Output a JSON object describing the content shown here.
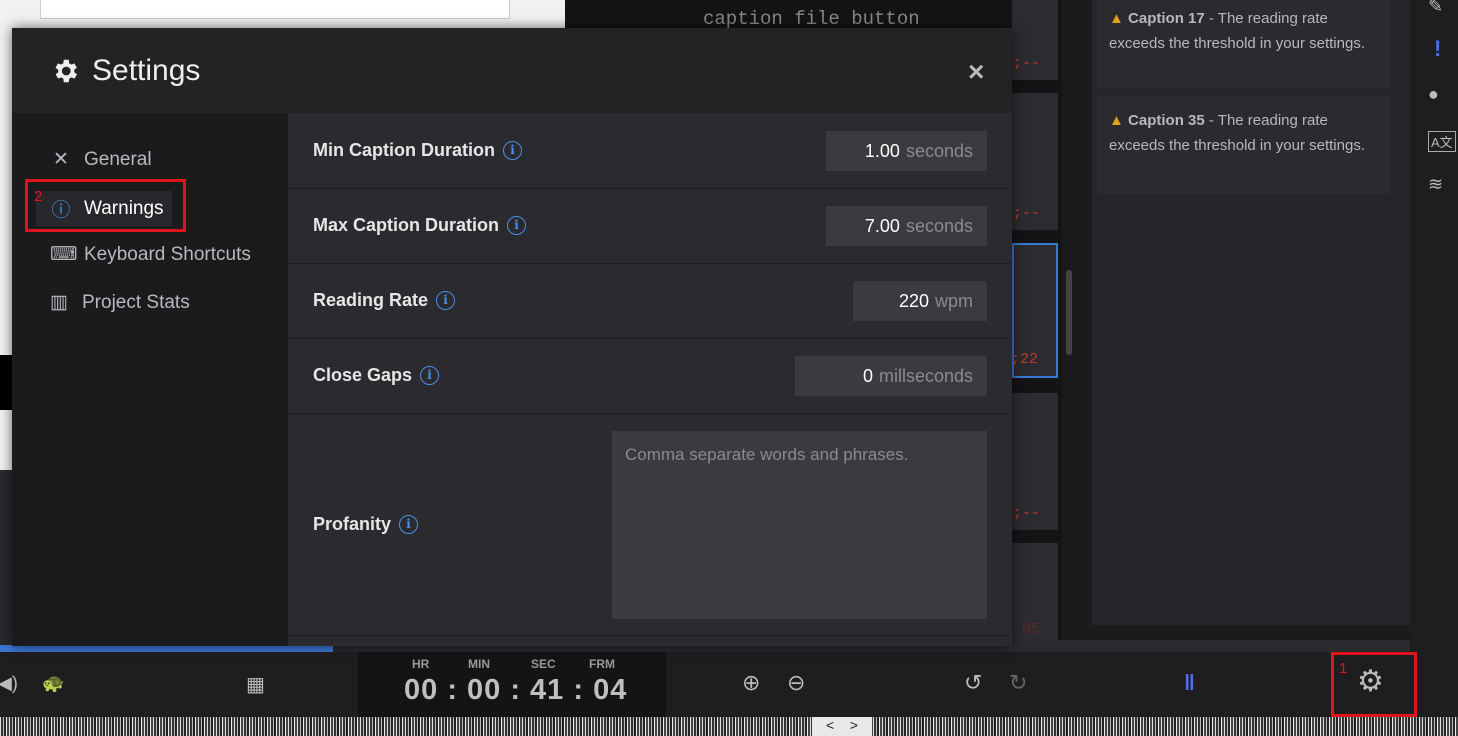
{
  "background": {
    "top_code": "caption file button",
    "caption_timecodes": [
      ";--",
      ";--",
      ";22",
      ";--",
      "05"
    ]
  },
  "warnings_panel": {
    "items": [
      {
        "caption": "Caption 17",
        "message": " - The reading rate exceeds the threshold in your settings."
      },
      {
        "caption": "Caption 35",
        "message": " - The reading rate exceeds the threshold in your settings."
      }
    ]
  },
  "modal": {
    "title": "Settings",
    "close_label": "×",
    "nav": [
      {
        "label": "General",
        "icon": "tools-icon"
      },
      {
        "label": "Warnings",
        "icon": "exclamation-circle-icon"
      },
      {
        "label": "Keyboard Shortcuts",
        "icon": "keyboard-icon"
      },
      {
        "label": "Project Stats",
        "icon": "bar-chart-icon"
      }
    ],
    "active_nav": "Warnings",
    "settings": {
      "min_duration": {
        "label": "Min Caption Duration",
        "value": "1.00",
        "unit": "seconds"
      },
      "max_duration": {
        "label": "Max Caption Duration",
        "value": "7.00",
        "unit": "seconds"
      },
      "reading_rate": {
        "label": "Reading Rate",
        "value": "220",
        "unit": "wpm"
      },
      "close_gaps": {
        "label": "Close Gaps",
        "value": "0",
        "unit": "millseconds"
      },
      "profanity": {
        "label": "Profanity",
        "placeholder": "Comma separate words and phrases."
      }
    }
  },
  "timecode": {
    "labels": {
      "hr": "HR",
      "min": "MIN",
      "sec": "SEC",
      "frm": "FRM"
    },
    "value": "00 : 00 : 41 : 04"
  },
  "annotations": {
    "one": "1",
    "two": "2"
  },
  "waveform_nav": {
    "prev": "<",
    "next": ">"
  },
  "colors": {
    "accent": "#4a8fe8",
    "warning": "#e0a11b",
    "highlight": "#e0141a"
  }
}
